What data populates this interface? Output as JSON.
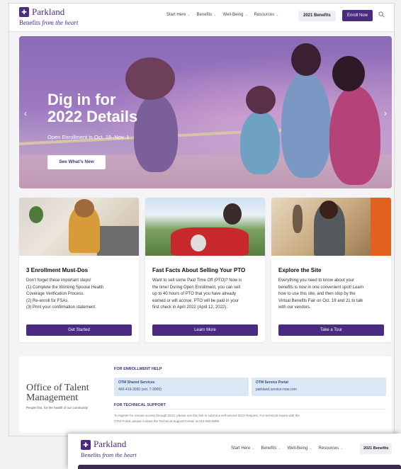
{
  "header": {
    "logo_name": "Parkland",
    "logo_tag_prefix": "Benefits",
    "logo_tag_italic": "from the heart",
    "nav": [
      "Start Here",
      "Benefits",
      "Well-Being",
      "Resources"
    ],
    "btn_benefits": "2021 Benefits",
    "btn_enroll": "Enroll Now"
  },
  "hero": {
    "title_line1": "Dig in for",
    "title_line2": "2022 Details",
    "subtitle": "Open Enrollment is Oct. 18–Nov. 1",
    "button": "See What’s New"
  },
  "cards": [
    {
      "title": "3 Enrollment Must-Dos",
      "lines": [
        "Don’t forget these important steps!",
        "(1) Complete the Working Spouse Health",
        "Coverage Verification Process.",
        "(2) Re-enroll for FSAs.",
        "(3) Print your confirmation statement."
      ],
      "button": "Get Started"
    },
    {
      "title": "Fast Facts About Selling Your PTO",
      "lines": [
        "Want to sell some Paid Time Off (PTO)? Now is",
        "the time! During Open Enrollment, you can sell",
        "up to 40 hours of PTO that you have already",
        "earned or will accrue. PTO will be paid in your",
        "first check in April 2022 (April 12, 2022)."
      ],
      "button": "Learn More"
    },
    {
      "title": "Explore the Site",
      "lines": [
        "Everything you need to know about your",
        "benefits is now in one convenient spot! Learn",
        "how to use this site, and then stop by the",
        "Virtual Benefits Fair on Oct. 19 and 21 to talk",
        "with our vendors."
      ],
      "button": "Take a Tour"
    }
  ],
  "otm": {
    "title": "Office of Talent Management",
    "tagline": "People first, for the health of our community",
    "enroll_label": "FOR ENROLLMENT HELP",
    "box1_title": "OTM Shared Services",
    "box1_value": "469-419-3060 (ext. 7-3000)",
    "box2_title": "OTM Service Portal",
    "box2_value": "parkland.service-now.com",
    "tech_label": "FOR TECHNICAL SUPPORT",
    "tech_lines": [
      "To register for remote access through DUO, please use this link to submit a self-service DUO Request. For technical issues with the",
      "OTM Portal, please contact the Technical Support Center at 214-590-5899."
    ]
  },
  "second": {
    "logo_name": "Parkland",
    "logo_tag_prefix": "Benefits",
    "logo_tag_italic": "from the heart",
    "nav": [
      "Start Here",
      "Benefits",
      "Well-Being",
      "Resources"
    ],
    "btn_benefits": "2021 Benefits"
  },
  "colors": {
    "brand_purple": "#4b2a82",
    "info_blue": "#dbe7f5"
  }
}
